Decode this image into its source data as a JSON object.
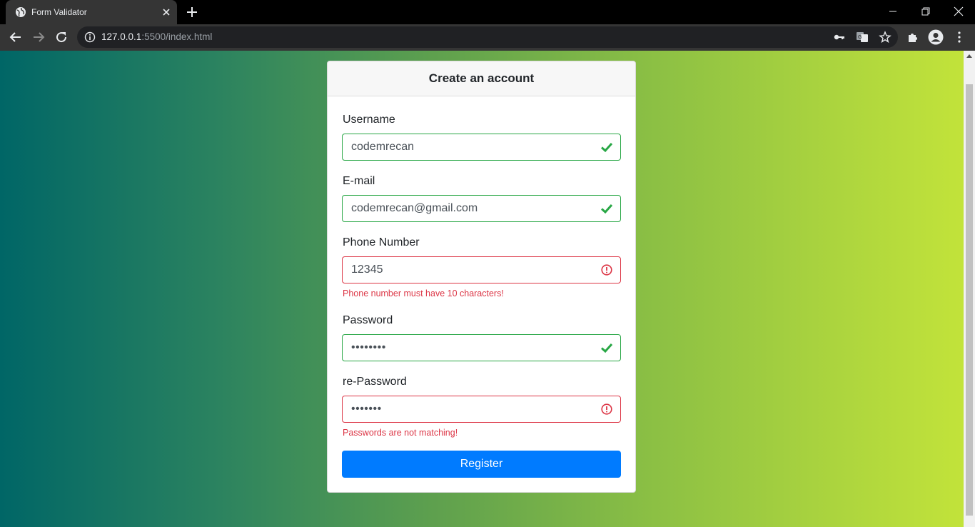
{
  "browser": {
    "tab_title": "Form Validator",
    "url_host": "127.0.0.1",
    "url_rest": ":5500/index.html"
  },
  "form": {
    "title": "Create an account",
    "fields": [
      {
        "label": "Username",
        "value": "codemrecan",
        "state": "valid"
      },
      {
        "label": "E-mail",
        "value": "codemrecan@gmail.com",
        "state": "valid"
      },
      {
        "label": "Phone Number",
        "value": "12345",
        "state": "invalid",
        "error": "Phone number must have 10 characters!"
      },
      {
        "label": "Password",
        "value": "••••••••",
        "state": "valid"
      },
      {
        "label": "re-Password",
        "value": "•••••••",
        "state": "invalid",
        "error": "Passwords are not matching!"
      }
    ],
    "submit_label": "Register"
  },
  "colors": {
    "valid": "#28a745",
    "invalid": "#dc3545",
    "primary": "#007bff",
    "gradient_start": "#006666",
    "gradient_end": "#c2e33a"
  },
  "icons": {
    "valid": "check-icon",
    "invalid": "exclamation-circle-icon"
  }
}
